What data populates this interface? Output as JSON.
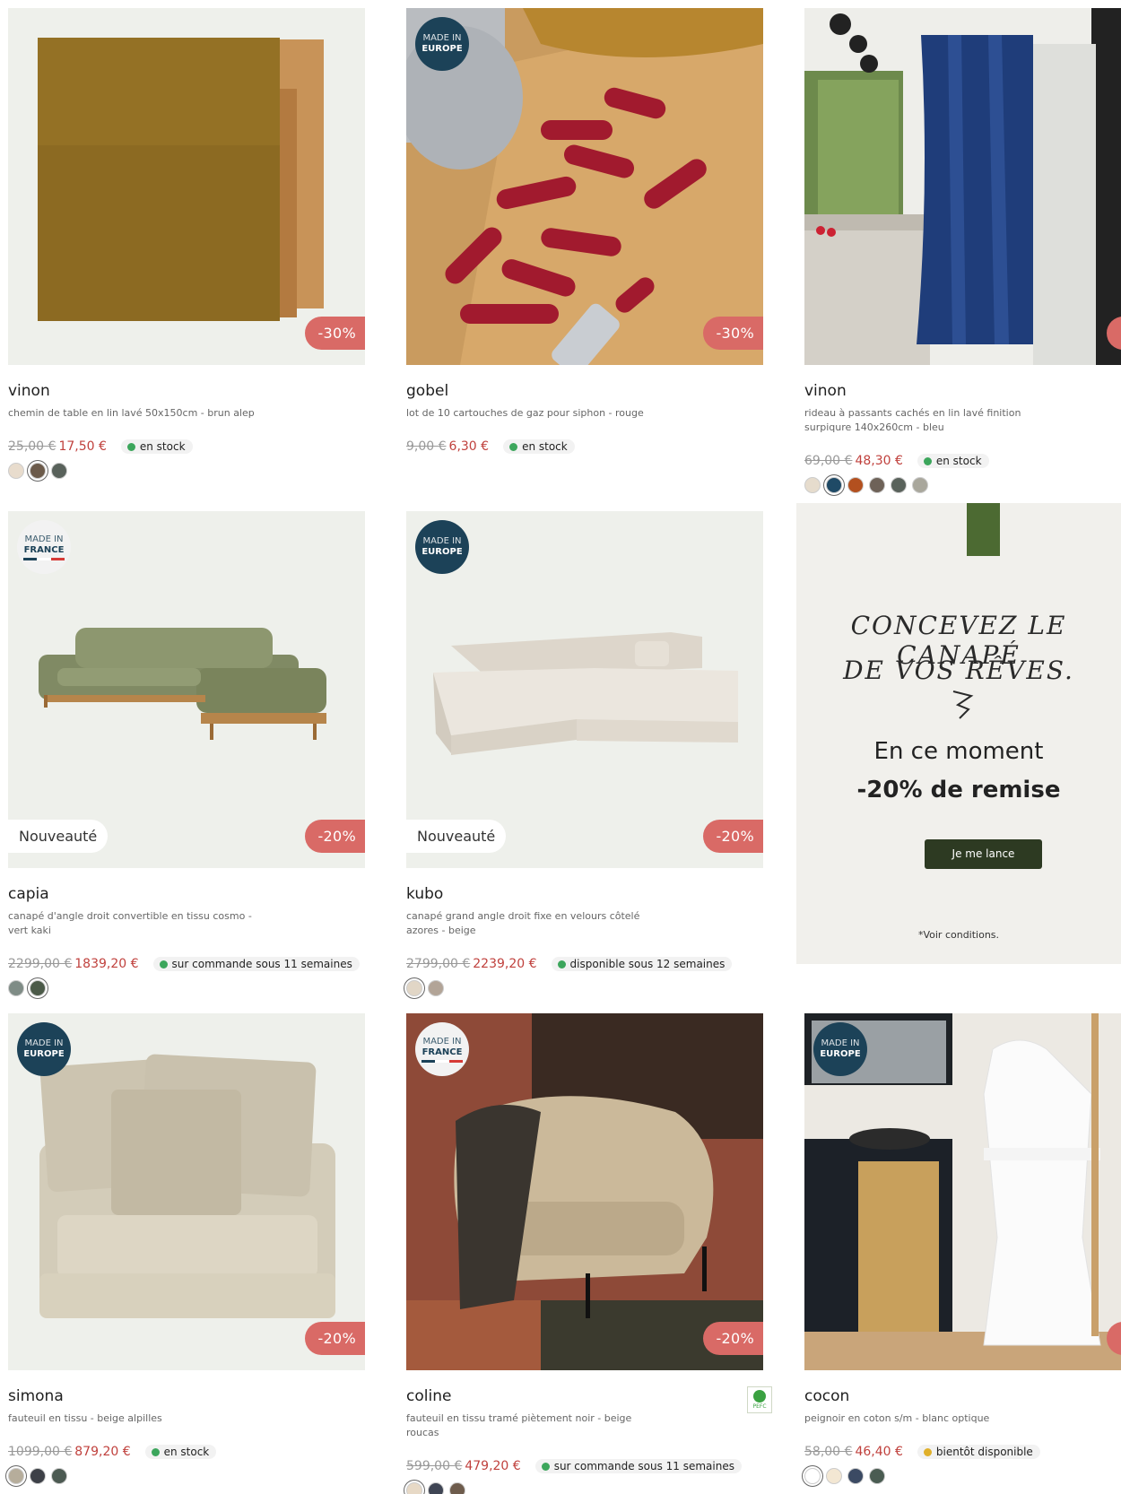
{
  "products": [
    {
      "name": "vinon",
      "desc": "chemin de table en lin lavé 50x150cm - brun alep",
      "old_price": "25,00 €",
      "price": "17,50 €",
      "stock": "en stock",
      "stock_color": "#3ca65c",
      "discount": "-30%",
      "swatches": [
        "#e8dccd",
        "#6b5a4a",
        "#59625b"
      ]
    },
    {
      "name": "gobel",
      "desc": "lot de 10 cartouches de gaz pour siphon - rouge",
      "old_price": "9,00 €",
      "price": "6,30 €",
      "stock": "en stock",
      "stock_color": "#3ca65c",
      "discount": "-30%",
      "made_in": "MADE IN",
      "made_region": "EUROPE",
      "swatches": []
    },
    {
      "name": "vinon",
      "desc": "rideau à passants cachés en lin lavé finition surpiqure 140x260cm - bleu",
      "old_price": "69,00 €",
      "price": "48,30 €",
      "stock": "en stock",
      "stock_color": "#3ca65c",
      "swatches": [
        "#e6dccd",
        "#1f4a66",
        "#b3501f",
        "#6e6258",
        "#59625b",
        "#a9a79c"
      ]
    },
    {
      "name": "capia",
      "desc": "canapé d'angle droit convertible en tissu cosmo - vert kaki",
      "old_price": "2299,00 €",
      "price": "1839,20 €",
      "stock": "sur commande sous 11 semaines",
      "stock_color": "#3ca65c",
      "discount": "-20%",
      "badge": "Nouveauté",
      "made_in": "MADE IN",
      "made_region": "FRANCE",
      "swatches": [
        "#7f8c86",
        "#4b5a48"
      ]
    },
    {
      "name": "kubo",
      "desc": "canapé grand angle droit fixe en velours côtelé azores - beige",
      "old_price": "2799,00 €",
      "price": "2239,20 €",
      "stock": "disponible sous 12 semaines",
      "stock_color": "#3ca65c",
      "discount": "-20%",
      "badge": "Nouveauté",
      "made_in": "MADE IN",
      "made_region": "EUROPE",
      "swatches": [
        "#e1d6c6",
        "#b2a497"
      ]
    },
    {
      "name": "simona",
      "desc": "fauteuil en tissu - beige alpilles",
      "old_price": "1099,00 €",
      "price": "879,20 €",
      "stock": "en stock",
      "stock_color": "#3ca65c",
      "discount": "-20%",
      "made_in": "MADE IN",
      "made_region": "EUROPE",
      "swatches": [
        "#b6ad9b",
        "#3d4047",
        "#4c5a52"
      ]
    },
    {
      "name": "coline",
      "desc": "fauteuil en tissu tramé piètement noir - beige roucas",
      "old_price": "599,00 €",
      "price": "479,20 €",
      "stock": "sur commande sous 11 semaines",
      "stock_color": "#3ca65c",
      "discount": "-20%",
      "made_in": "MADE IN",
      "made_region": "FRANCE",
      "pefc": "PEFC",
      "swatches": [
        "#e7d9c6",
        "#3f4554",
        "#6e5c4c"
      ]
    },
    {
      "name": "cocon",
      "desc": "peignoir en coton s/m - blanc optique",
      "old_price": "58,00 €",
      "price": "46,40 €",
      "stock": "bientôt disponible",
      "stock_color": "#e0b02a",
      "made_in": "MADE IN",
      "made_region": "EUROPE",
      "swatches": [
        "#ffffff",
        "#f3e7d3",
        "#3b4a63",
        "#4a5c52"
      ]
    }
  ],
  "promo": {
    "line1": "CONCEVEZ LE CANAPÉ",
    "line2": "DE VOS RÊVES.",
    "moment": "En ce moment",
    "remise": "-20% de remise",
    "cta": "Je me lance",
    "conditions": "*Voir conditions."
  }
}
